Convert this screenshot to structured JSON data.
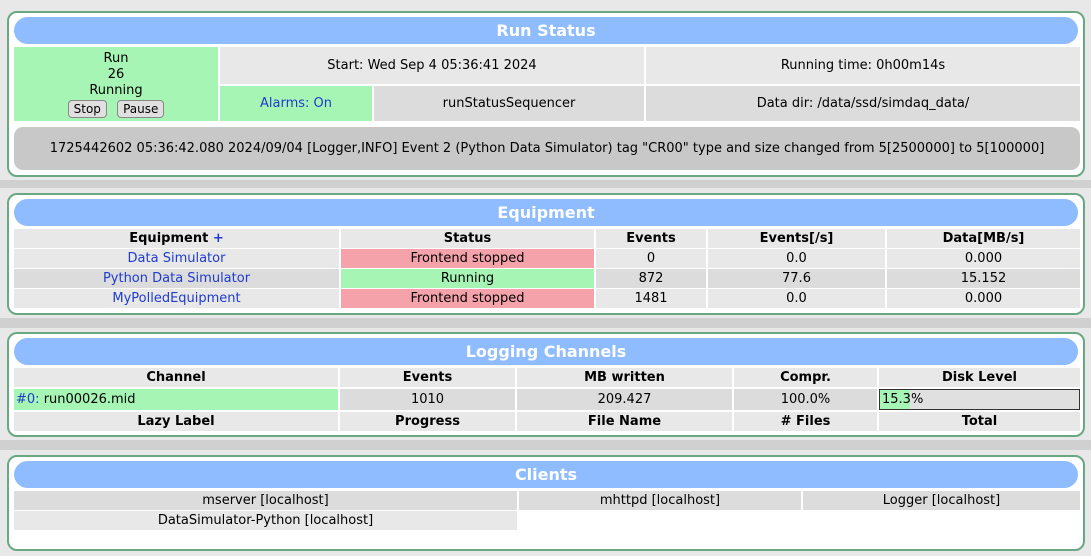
{
  "run_status": {
    "title": "Run Status",
    "run_label": "Run",
    "run_number": "26",
    "state": "Running",
    "stop_label": "Stop",
    "pause_label": "Pause",
    "start_text": "Start: Wed Sep 4 05:36:41 2024",
    "running_time_text": "Running time: 0h00m14s",
    "alarms_text": "Alarms: On",
    "sequencer_text": "runStatusSequencer",
    "data_dir_text": "Data dir: /data/ssd/simdaq_data/",
    "message": "1725442602 05:36:42.080 2024/09/04 [Logger,INFO] Event 2 (Python Data Simulator) tag \"CR00\" type and size changed from 5[2500000] to 5[100000]"
  },
  "equipment": {
    "title": "Equipment",
    "columns": [
      "Equipment",
      "Status",
      "Events",
      "Events[/s]",
      "Data[MB/s]"
    ],
    "add_label": "+",
    "rows": [
      {
        "name": "Data Simulator",
        "status": "Frontend stopped",
        "events": "0",
        "rate": "0.0",
        "data": "0.000"
      },
      {
        "name": "Python Data Simulator",
        "status": "Running",
        "events": "872",
        "rate": "77.6",
        "data": "15.152"
      },
      {
        "name": "MyPolledEquipment",
        "status": "Frontend stopped",
        "events": "1481",
        "rate": "0.0",
        "data": "0.000"
      }
    ]
  },
  "logging": {
    "title": "Logging Channels",
    "columns": [
      "Channel",
      "Events",
      "MB written",
      "Compr.",
      "Disk Level"
    ],
    "channel_id": "#0:",
    "channel_file": "run00026.mid",
    "events": "1010",
    "mb_written": "209.427",
    "compr": "100.0%",
    "disk_level_text": "15.3%",
    "disk_level_fraction": 0.153,
    "lazy_columns": [
      "Lazy Label",
      "Progress",
      "File Name",
      "# Files",
      "Total"
    ]
  },
  "clients": {
    "title": "Clients",
    "items": [
      "mserver [localhost]",
      "mhttpd [localhost]",
      "Logger [localhost]",
      "DataSimulator-Python [localhost]"
    ]
  },
  "colors": {
    "header": "#8fbcff",
    "ok_green": "#a6f5b4",
    "alarm_red": "#f5a2ab",
    "border": "#6aa884"
  }
}
